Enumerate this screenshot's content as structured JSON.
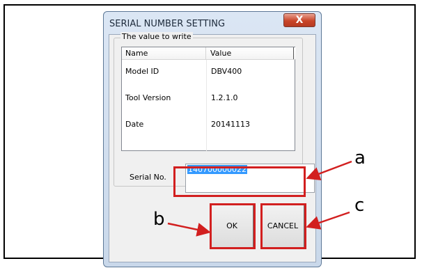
{
  "dialog": {
    "title": "SERIAL NUMBER SETTING",
    "close_label": "X",
    "group_label": "The value to write",
    "columns": [
      "Name",
      "Value"
    ],
    "rows": [
      {
        "name": "Model ID",
        "value": "DBV400"
      },
      {
        "name": "Tool Version",
        "value": "1.2.1.0"
      },
      {
        "name": "Date",
        "value": "20141113"
      }
    ],
    "serial": {
      "label": "Serial No.",
      "value": "140700000022"
    },
    "buttons": {
      "ok": "OK",
      "cancel": "CANCEL"
    }
  },
  "callouts": {
    "a": "a",
    "b": "b",
    "c": "c"
  },
  "colors": {
    "callout": "#d21f1f",
    "selection": "#3399ff"
  }
}
